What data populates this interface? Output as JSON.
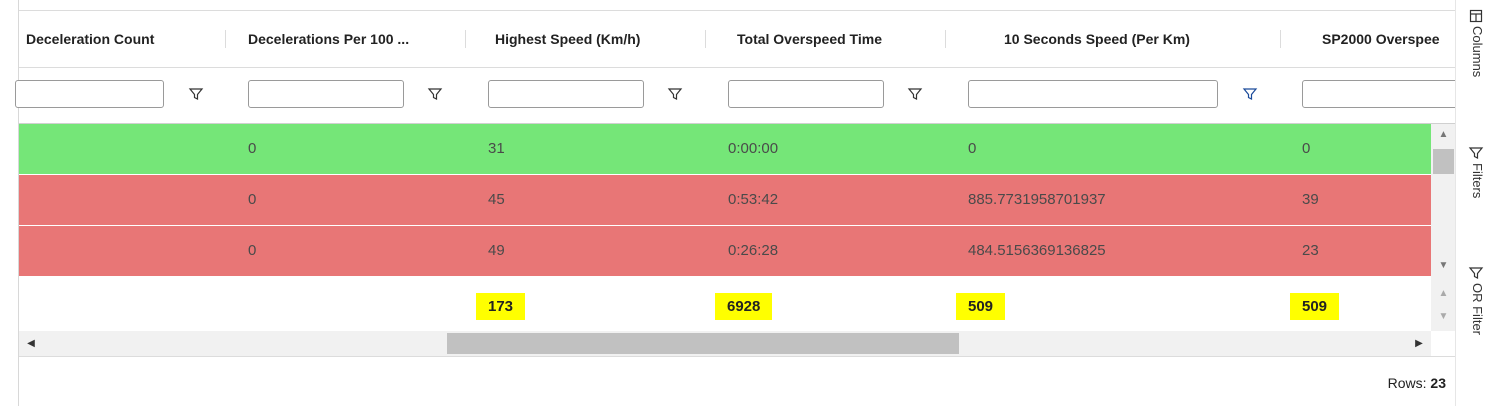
{
  "columns": [
    {
      "header": "Deceleration Count"
    },
    {
      "header": "Decelerations Per 100 ..."
    },
    {
      "header": "Highest Speed (Km/h)"
    },
    {
      "header": "Total Overspeed Time"
    },
    {
      "header": "10 Seconds Speed (Per Km)"
    },
    {
      "header": "SP2000 Overspee"
    }
  ],
  "rows": [
    {
      "status": "green",
      "color": "#75e678",
      "cells": [
        "0",
        "31",
        "0:00:00",
        "0",
        "0"
      ]
    },
    {
      "status": "red",
      "color": "#e87676",
      "cells": [
        "0",
        "45",
        "0:53:42",
        "885.7731958701937",
        "39"
      ]
    },
    {
      "status": "red",
      "color": "#e87676",
      "cells": [
        "0",
        "49",
        "0:26:28",
        "484.5156369136825",
        "23"
      ]
    }
  ],
  "totals": [
    "173",
    "6928",
    "509",
    "509"
  ],
  "status_bar": {
    "rows_label": "Rows:",
    "rows_count": "23"
  },
  "side_panel": [
    {
      "label": "Columns",
      "icon": "columns-icon"
    },
    {
      "label": "Filters",
      "icon": "filter-icon"
    },
    {
      "label": "OR Filter",
      "icon": "filter-icon"
    }
  ],
  "colors": {
    "highlight": "#ffff00",
    "ok_row": "#75e678",
    "alert_row": "#e87676"
  }
}
